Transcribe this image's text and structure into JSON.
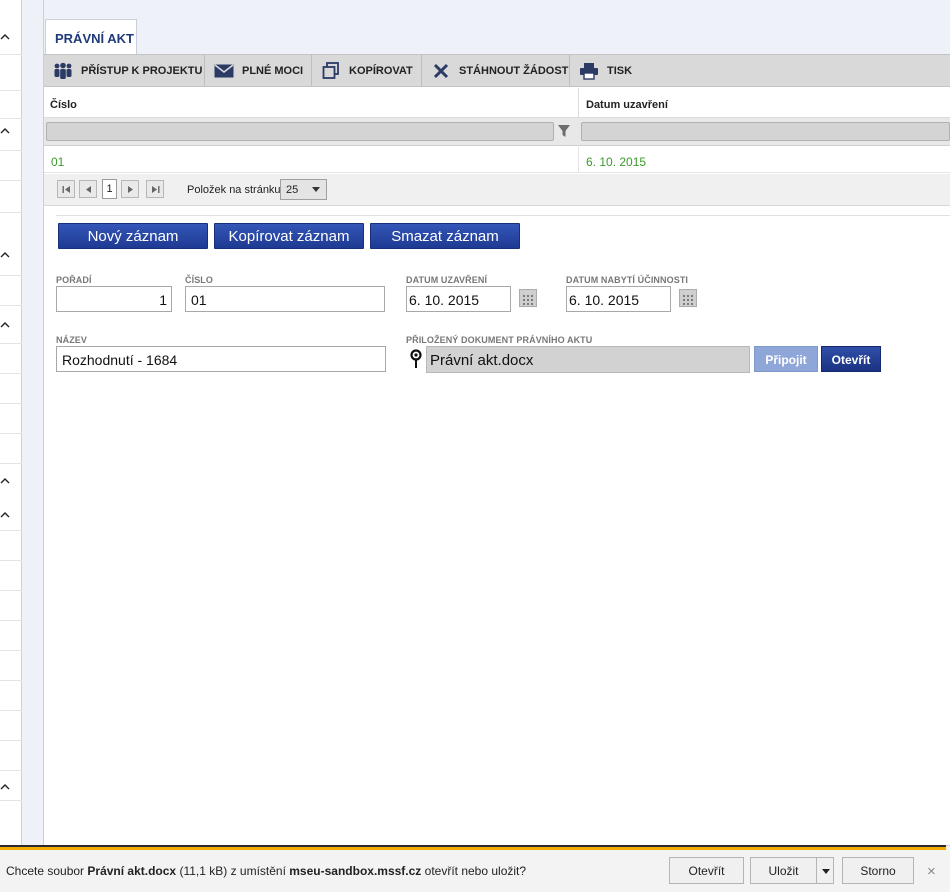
{
  "tab": {
    "label": "PRÁVNÍ AKT"
  },
  "toolbar": {
    "access": "PŘÍSTUP K PROJEKTU",
    "poa": "PLNÉ MOCI",
    "copy": "KOPÍROVAT",
    "delete": "STÁHNOUT ŽÁDOST",
    "print": "TISK"
  },
  "grid": {
    "columns": [
      "Číslo",
      "Datum uzavření"
    ],
    "rows": [
      {
        "cislo": "01",
        "datum": "6. 10. 2015"
      }
    ]
  },
  "pager": {
    "current_page": "1",
    "per_page_label": "Položek na stránku",
    "per_page_value": "25"
  },
  "actions": {
    "new": "Nový záznam",
    "copy": "Kopírovat záznam",
    "delete": "Smazat záznam"
  },
  "form": {
    "poradi_label": "POŘADÍ",
    "poradi_value": "1",
    "cislo_label": "ČÍSLO",
    "cislo_value": "01",
    "datum_uzavreni_label": "DATUM UZAVŘENÍ",
    "datum_uzavreni_value": "6. 10. 2015",
    "datum_ucinnosti_label": "DATUM NABYTÍ ÚČINNOSTI",
    "datum_ucinnosti_value": "6. 10. 2015",
    "nazev_label": "NÁZEV",
    "nazev_value": "Rozhodnutí - 1684",
    "dokument_label": "PŘILOŽENÝ DOKUMENT PRÁVNÍHO AKTU",
    "dokument_value": "Právní akt.docx",
    "pripojit": "Připojit",
    "otevrit": "Otevřít"
  },
  "download_bar": {
    "prefix": "Chcete soubor ",
    "filename": "Právní akt.docx",
    "size": " (11,1 kB) z umístění ",
    "host": "mseu-sandbox.mssf.cz",
    "suffix": " otevřít nebo uložit?",
    "open": "Otevřít",
    "save": "Uložit",
    "cancel": "Storno",
    "close": "×"
  },
  "colors": {
    "accent_blue": "#1e3a93",
    "data_green": "#3c9a2c",
    "download_accent": "#f2a900"
  }
}
